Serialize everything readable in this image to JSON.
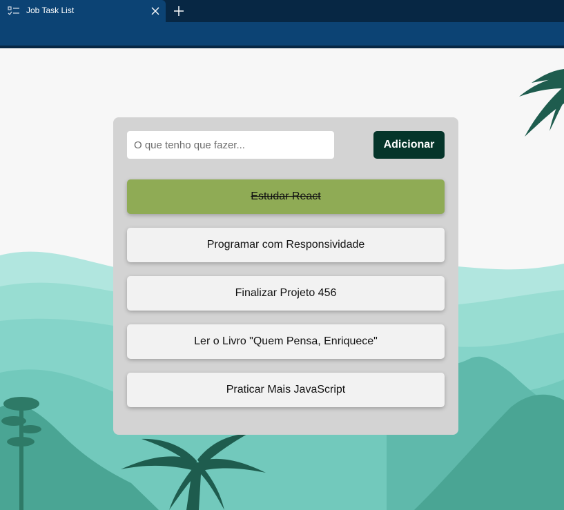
{
  "browser": {
    "tab_title": "Job Task List",
    "colors": {
      "chrome": "#0c4374",
      "tab_strip": "#072744"
    }
  },
  "form": {
    "input_value": "",
    "input_placeholder": "O que tenho que fazer...",
    "add_label": "Adicionar"
  },
  "tasks": [
    {
      "label": "Estudar React",
      "done": true
    },
    {
      "label": "Programar com Responsividade",
      "done": false
    },
    {
      "label": "Finalizar Projeto 456",
      "done": false
    },
    {
      "label": "Ler o Livro \"Quem Pensa, Enriquece\"",
      "done": false
    },
    {
      "label": "Praticar Mais JavaScript",
      "done": false
    }
  ],
  "colors": {
    "done_task": "#8fab55",
    "pending_task": "#f2f2f2",
    "add_button": "#05352a",
    "card": "#d3d3d3"
  },
  "icons": {
    "favicon": "task-list-icon",
    "close": "close-icon",
    "new_tab": "plus-icon"
  }
}
